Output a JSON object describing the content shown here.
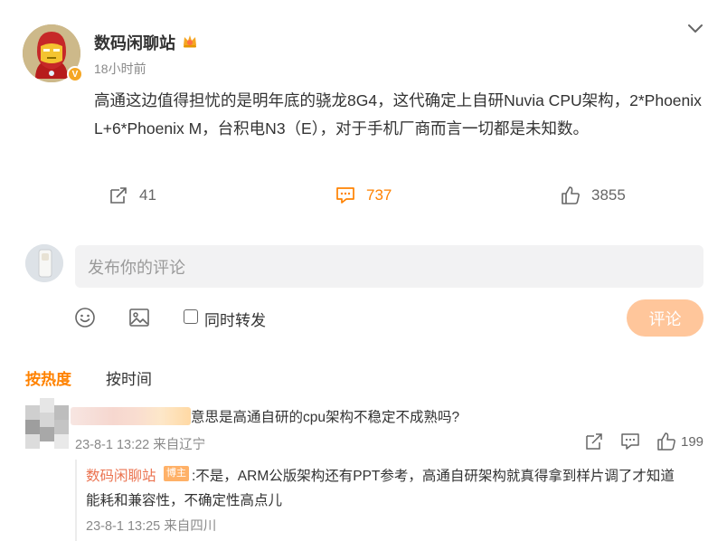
{
  "post": {
    "author": "数码闲聊站",
    "time": "18小时前",
    "verified_mark": "V",
    "content": "高通这边值得担忧的是明年底的骁龙8G4，这代确定上自研Nuvia CPU架构，2*Phoenix L+6*Phoenix M，台积电N3（E），对于手机厂商而言一切都是未知数。",
    "repost_count": "41",
    "comment_count": "737",
    "like_count": "3855"
  },
  "composer": {
    "placeholder": "发布你的评论",
    "repost_label": "同时转发",
    "submit_label": "评论"
  },
  "sort_tabs": {
    "hot": "按热度",
    "time": "按时间"
  },
  "comment": {
    "text": "意思是高通自研的cpu架构不稳定不成熟吗?",
    "meta": "23-8-1 13:22 来自辽宁",
    "like_count": "199"
  },
  "reply": {
    "author": "数码闲聊站",
    "badge": "博主",
    "line1": ":不是，ARM公版架构还有PPT参考，高通自研架构就真得拿到样片调了才知道",
    "line2": "能耗和兼容性，不确定性高点儿",
    "meta": "23-8-1 13:25 来自四川"
  },
  "colors": {
    "accent": "#ff8200",
    "reply_author": "#eb7350",
    "submit_disabled": "#ffc69b",
    "input_bg": "#f2f2f3"
  },
  "icons": [
    "chevron-down-icon",
    "repost-icon",
    "comment-icon",
    "like-icon",
    "emoji-icon",
    "image-icon",
    "checkbox-icon"
  ]
}
